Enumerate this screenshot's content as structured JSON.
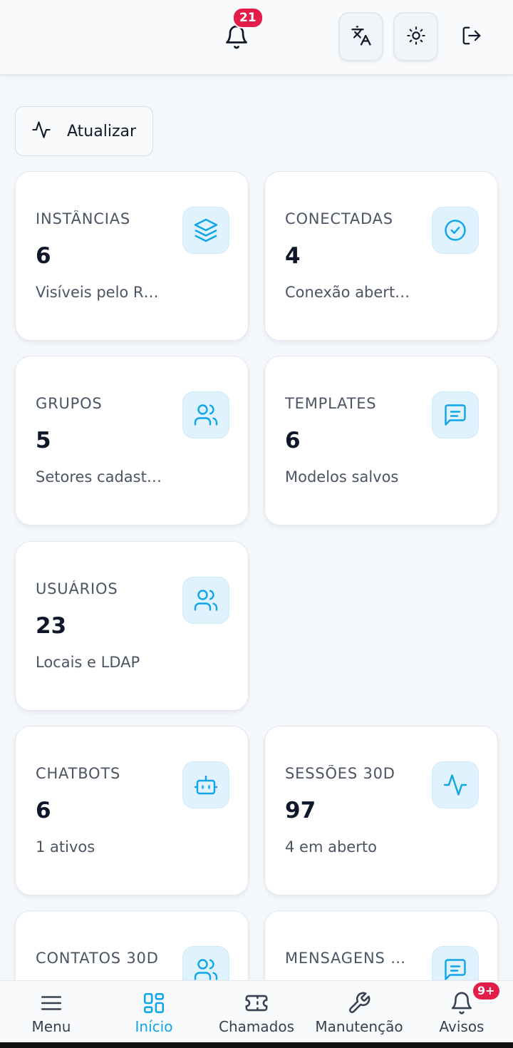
{
  "header": {
    "notification_count": "21",
    "translate_icon": "translate-icon",
    "theme_icon": "sun-icon",
    "logout_icon": "logout-icon"
  },
  "refresh": {
    "label": "Atualizar",
    "icon": "activity-icon"
  },
  "cards": [
    {
      "title": "INSTÂNCIAS",
      "value": "6",
      "subtitle": "Visíveis pelo R…",
      "icon": "layers-icon"
    },
    {
      "title": "CONECTADAS",
      "value": "4",
      "subtitle": "Conexão abert…",
      "icon": "check-circle-icon"
    },
    {
      "title": "GRUPOS",
      "value": "5",
      "subtitle": "Setores cadast…",
      "icon": "users-icon"
    },
    {
      "title": "TEMPLATES",
      "value": "6",
      "subtitle": "Modelos salvos",
      "icon": "message-square-icon"
    },
    {
      "title": "USUÁRIOS",
      "value": "23",
      "subtitle": "Locais e LDAP",
      "icon": "users-icon"
    },
    {
      "title": "CHATBOTS",
      "value": "6",
      "subtitle": "1 ativos",
      "icon": "bot-icon"
    },
    {
      "title": "SESSÕES 30D",
      "value": "97",
      "subtitle": "4 em aberto",
      "icon": "activity-icon"
    },
    {
      "title": "CONTATOS 30D",
      "value": "",
      "subtitle": "",
      "icon": "users-icon"
    },
    {
      "title": "MENSAGENS …",
      "value": "",
      "subtitle": "",
      "icon": "message-square-icon"
    }
  ],
  "bottom_nav": [
    {
      "label": "Menu",
      "icon": "menu-icon",
      "active": false
    },
    {
      "label": "Início",
      "icon": "grid-icon",
      "active": true
    },
    {
      "label": "Chamados",
      "icon": "ticket-icon",
      "active": false
    },
    {
      "label": "Manutenção",
      "icon": "wrench-icon",
      "active": false
    },
    {
      "label": "Avisos",
      "icon": "bell-icon",
      "active": false,
      "badge": "9+"
    }
  ],
  "colors": {
    "accent": "#0ea5e9",
    "badge": "#e11d48",
    "icon_bg": "#e0f2fe"
  }
}
